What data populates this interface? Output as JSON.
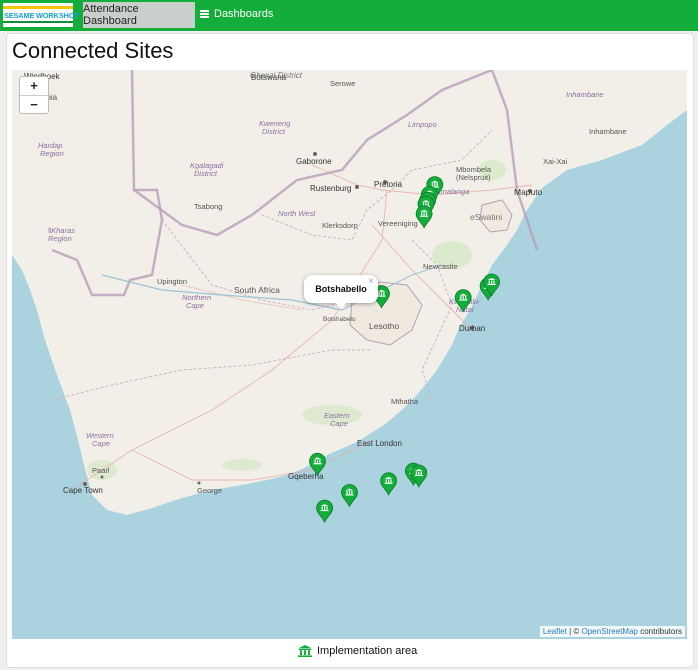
{
  "navbar": {
    "logo_text": "SESAME WORKSHOP",
    "active_tab": "Attendance Dashboard",
    "dashboards_label": "Dashboards"
  },
  "page": {
    "title": "Connected Sites"
  },
  "map": {
    "zoom_in": "+",
    "zoom_out": "−",
    "popup": {
      "text": "Botshabello",
      "close": "×"
    },
    "attribution": {
      "leaflet": "Leaflet",
      "sep": " | © ",
      "osm": "OpenStreetMap",
      "contributors": " contributors"
    },
    "labels": {
      "botswana": "Botswana",
      "serowe": "Serowe",
      "gaborone": "Gaborone",
      "rustenburg": "Rustenburg",
      "pretoria": "Pretoria",
      "klerksdorp": "Klerksdorp",
      "vereeniging": "Vereeniging",
      "mpumalanga": "Mpumalanga",
      "mbombela": "Mbombela",
      "nelspruit": "(Nelspruit)",
      "maputo": "Maputo",
      "eswatini": "eSwatini",
      "limpopo": "Limpopo",
      "north_west": "North West",
      "upington": "Upington",
      "northern_cape": "Northern",
      "northern_cape2": "Cape",
      "south_africa": "South Africa",
      "newcastle": "Newcastle",
      "lesotho": "Lesotho",
      "kwazulu": "KwaZulu-",
      "natal": "Natal",
      "durban": "Durban",
      "botshabelo": "Botshabelo",
      "eastern_cape": "Eastern",
      "eastern_cape2": "Cape",
      "mthatha": "Mthatha",
      "western_cape": "Western",
      "western_cape2": "Cape",
      "paarl": "Paarl",
      "cape_town": "Cape Town",
      "george": "George",
      "east_london": "East London",
      "gqeberha": "Gqeberha",
      "windhoek": "Windhoek",
      "namibia": "mibia",
      "hardap": "Hardap",
      "hardap2": "Region",
      "kharas": "ǁKharas",
      "kharas2": "Region",
      "kgalagadi": "Kgalagadi",
      "kgalagadi2": "District",
      "kweneng": "Kweneng",
      "kweneng2": "District",
      "tsabong": "Tsabong",
      "inhambane": "Inhambane",
      "inhambane_city": "Inhambane",
      "xai_xai": "Xai-Xai",
      "ghanzi": "Ghanzi District"
    },
    "site_icon": "museum-icon",
    "sites": [
      {
        "lng": 28.2,
        "lat": -25.7
      },
      {
        "lng": 28.05,
        "lat": -25.95
      },
      {
        "lng": 28.0,
        "lat": -26.1
      },
      {
        "lng": 27.95,
        "lat": -26.2
      },
      {
        "lng": 27.9,
        "lat": -26.45
      },
      {
        "lng": 26.7,
        "lat": -28.5
      },
      {
        "lng": 29.0,
        "lat": -28.6
      },
      {
        "lng": 29.7,
        "lat": -28.3
      },
      {
        "lng": 29.8,
        "lat": -28.2
      },
      {
        "lng": 24.9,
        "lat": -32.8
      },
      {
        "lng": 26.9,
        "lat": -33.3
      },
      {
        "lng": 27.6,
        "lat": -33.05
      },
      {
        "lng": 27.75,
        "lat": -33.1
      },
      {
        "lng": 25.8,
        "lat": -33.6
      },
      {
        "lng": 25.1,
        "lat": -34.0
      }
    ]
  },
  "legend": {
    "icon": "museum-icon",
    "label": "Implementation area"
  },
  "colors": {
    "navbar": "#13ad3b",
    "marker": "#13ad3b",
    "water": "#aad3df",
    "land": "#f2efe9"
  }
}
